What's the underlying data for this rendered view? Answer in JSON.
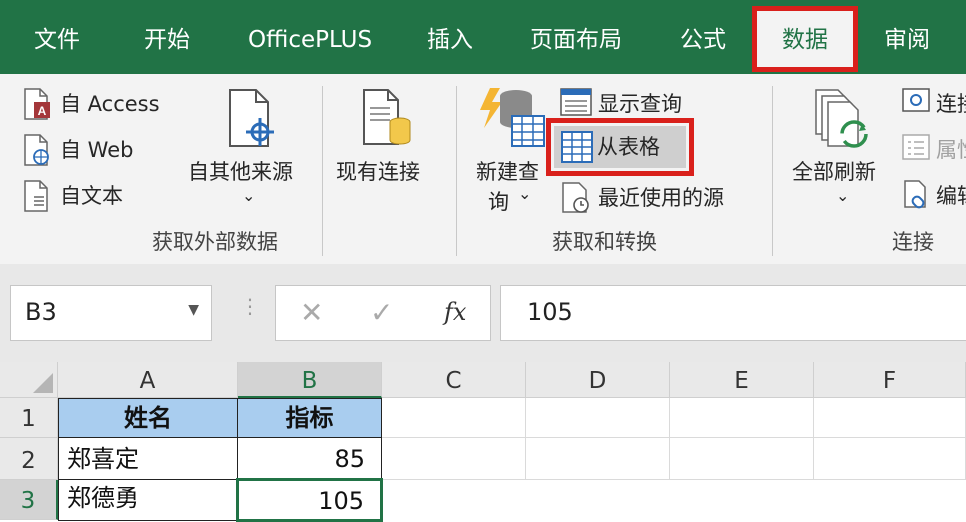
{
  "tabs": [
    "文件",
    "开始",
    "OfficePLUS",
    "插入",
    "页面布局",
    "公式",
    "数据",
    "审阅"
  ],
  "active_tab": "数据",
  "ribbon": {
    "get_external": {
      "access": "自 Access",
      "web": "自 Web",
      "text": "自文本",
      "other_sources": "自其他来源",
      "existing_connections": "现有连接",
      "group_label": "获取外部数据"
    },
    "get_transform": {
      "new_query_line1": "新建查",
      "new_query_line2": "询",
      "show_queries": "显示查询",
      "from_table": "从表格",
      "recent_sources": "最近使用的源",
      "group_label": "获取和转换"
    },
    "connections": {
      "refresh_all": "全部刷新",
      "connections": "连接",
      "properties": "属性",
      "edit_links": "编辑",
      "group_label": "连接"
    }
  },
  "formula_bar": {
    "name_box": "B3",
    "formula_value": "105",
    "fx": "fx"
  },
  "grid": {
    "columns": [
      "A",
      "B",
      "C",
      "D",
      "E",
      "F"
    ],
    "rows": [
      "1",
      "2",
      "3"
    ],
    "headers": [
      "姓名",
      "指标"
    ],
    "data": [
      [
        "郑喜定",
        "85"
      ],
      [
        "郑德勇",
        "105"
      ]
    ]
  },
  "colors": {
    "excel_green": "#217346",
    "highlight_red": "#d9201b",
    "header_fill": "#a9cdef"
  }
}
